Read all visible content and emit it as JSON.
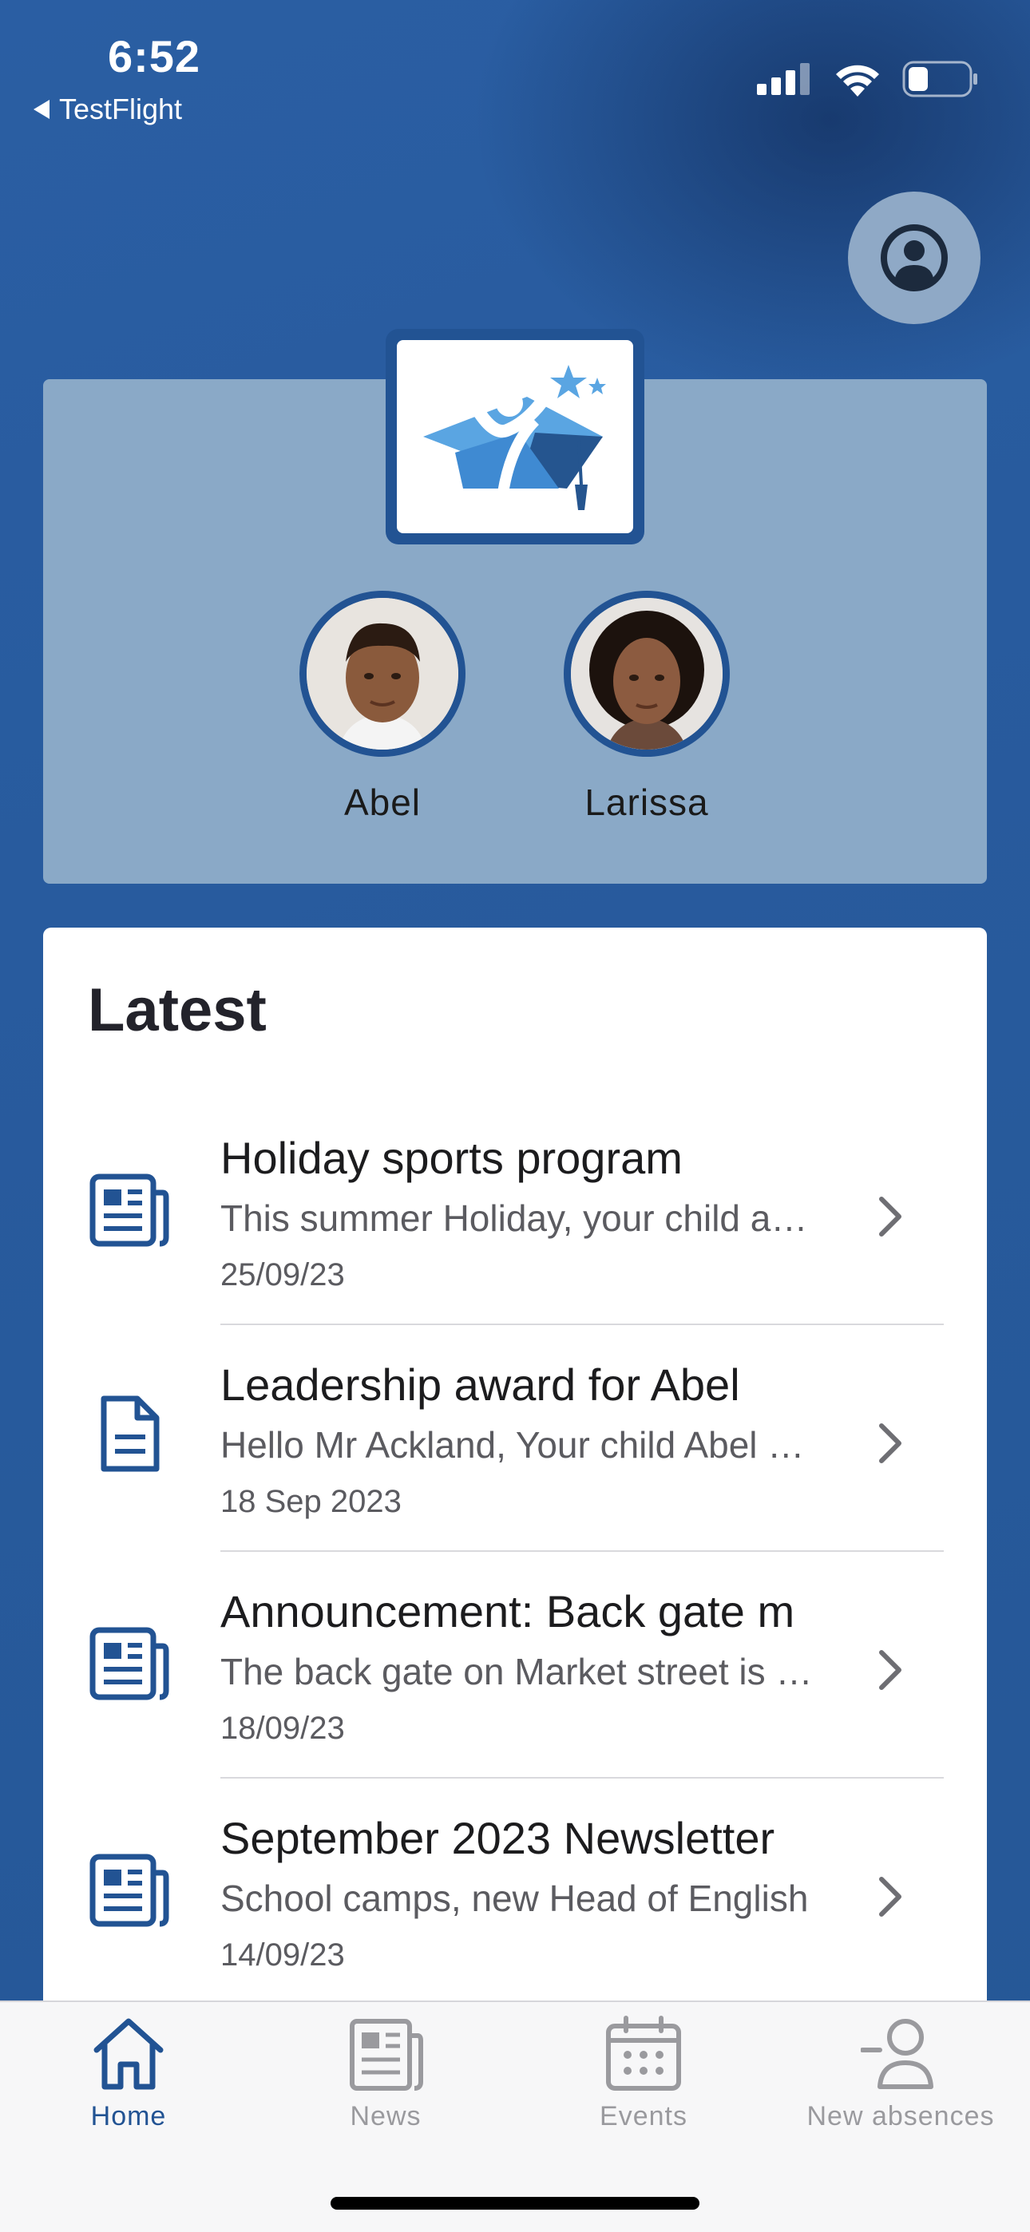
{
  "status_bar": {
    "time": "6:52",
    "back_app": "TestFlight",
    "icons": [
      "signal-icon",
      "wifi-icon",
      "battery-icon"
    ]
  },
  "header": {
    "profile_icon": "user-circle-icon",
    "logo": "school-logo"
  },
  "children": [
    {
      "name": "Abel"
    },
    {
      "name": "Larissa"
    }
  ],
  "latest": {
    "title": "Latest",
    "items": [
      {
        "icon": "newspaper-icon",
        "title": "Holiday sports program",
        "snippet": "This summer Holiday, your child attends",
        "date": "25/09/23"
      },
      {
        "icon": "document-icon",
        "title": "Leadership award for Abel",
        "snippet": "Hello Mr Ackland, Your child Abel has",
        "date": "18 Sep 2023"
      },
      {
        "icon": "newspaper-icon",
        "title": "Announcement: Back gate m",
        "snippet": "The back gate on Market street is closed",
        "date": "18/09/23"
      },
      {
        "icon": "newspaper-icon",
        "title": "September 2023 Newsletter",
        "snippet": "School camps, new Head of English",
        "date": "14/09/23"
      }
    ]
  },
  "tabs": [
    {
      "label": "Home",
      "icon": "home-icon",
      "active": true
    },
    {
      "label": "News",
      "icon": "news-icon",
      "active": false
    },
    {
      "label": "Events",
      "icon": "calendar-icon",
      "active": false
    },
    {
      "label": "New absences",
      "icon": "person-add-icon",
      "active": false
    }
  ],
  "colors": {
    "primary": "#225393",
    "background": "#285b9e",
    "hero_card": "#8aa9c7",
    "inactive": "#9a9a9e"
  }
}
